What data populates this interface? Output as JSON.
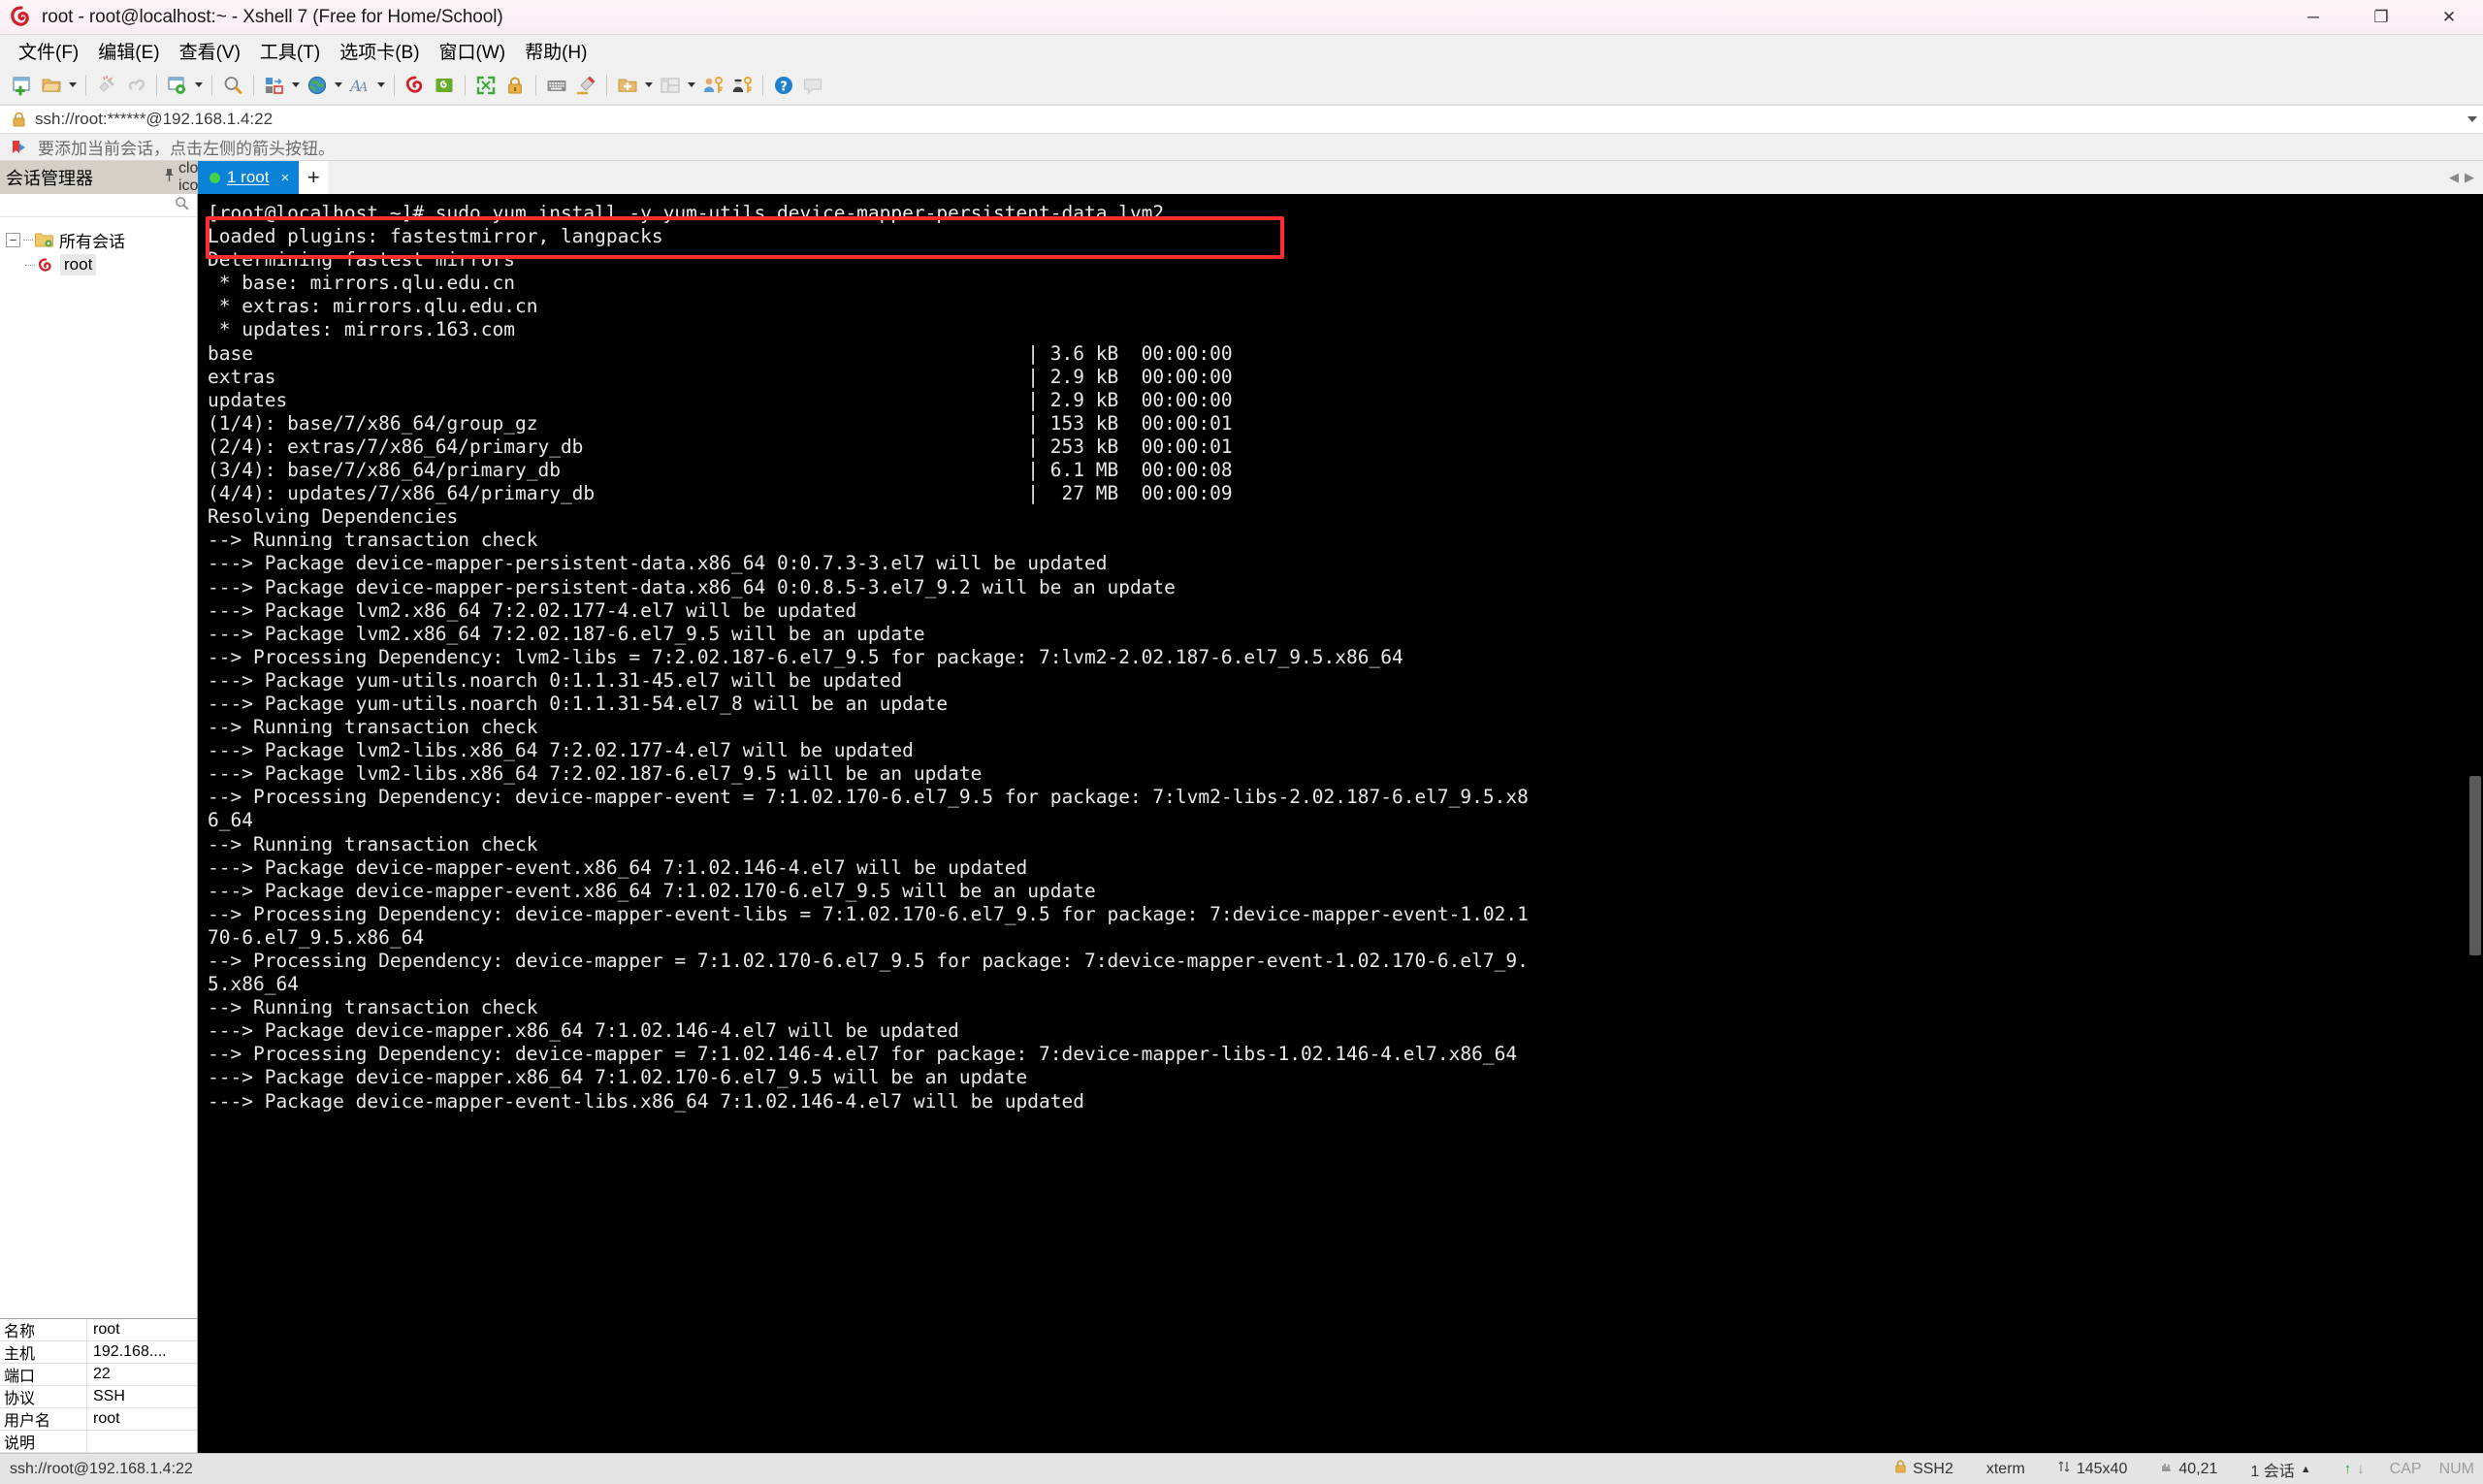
{
  "window": {
    "title": "root - root@localhost:~ - Xshell 7 (Free for Home/School)",
    "app_icon": "xshell-logo-icon",
    "minimize": "─",
    "maximize": "❐",
    "close": "✕"
  },
  "menubar": [
    {
      "label": "文件(F)",
      "name": "menu-file"
    },
    {
      "label": "编辑(E)",
      "name": "menu-edit"
    },
    {
      "label": "查看(V)",
      "name": "menu-view"
    },
    {
      "label": "工具(T)",
      "name": "menu-tools"
    },
    {
      "label": "选项卡(B)",
      "name": "menu-tabs"
    },
    {
      "label": "窗口(W)",
      "name": "menu-window"
    },
    {
      "label": "帮助(H)",
      "name": "menu-help"
    }
  ],
  "addressbar": {
    "value": "ssh://root:******@192.168.1.4:22",
    "lock_icon": "lock-icon",
    "dropdown_icon": "chevron-down-icon"
  },
  "hintbar": {
    "icon": "bookmark-arrow-icon",
    "text": "要添加当前会话，点击左侧的箭头按钮。"
  },
  "session_manager": {
    "title": "会话管理器",
    "pin_icon": "pin-icon",
    "close_icon": "close-icon",
    "search_icon": "search-icon",
    "tree": {
      "root_label": "所有会话",
      "root_icon": "folder-sessions-icon",
      "toggle": "−",
      "children": [
        {
          "label": "root",
          "icon": "xshell-session-icon",
          "selected": true
        }
      ]
    },
    "properties": [
      {
        "key": "名称",
        "value": "root"
      },
      {
        "key": "主机",
        "value": "192.168...."
      },
      {
        "key": "端口",
        "value": "22"
      },
      {
        "key": "协议",
        "value": "SSH"
      },
      {
        "key": "用户名",
        "value": "root"
      },
      {
        "key": "说明",
        "value": ""
      }
    ]
  },
  "tabs": {
    "items": [
      {
        "label": "1 root",
        "status_color": "#43d14b",
        "close": "×",
        "active": true
      }
    ],
    "new_tab": "+",
    "nav_prev": "◀",
    "nav_next": "▶"
  },
  "toolbar": {
    "groups": [
      [
        {
          "name": "new-session-icon",
          "dropdown": false
        },
        {
          "name": "open-folder-icon",
          "dropdown": true
        }
      ],
      [
        {
          "name": "disconnect-icon",
          "dropdown": false
        },
        {
          "name": "reconnect-icon",
          "dropdown": false
        }
      ],
      [
        {
          "name": "session-properties-icon",
          "dropdown": true
        }
      ],
      [
        {
          "name": "find-icon",
          "dropdown": false
        }
      ],
      [
        {
          "name": "layout-arrange-icon",
          "dropdown": true
        }
      ],
      [
        {
          "name": "globe-encoding-icon",
          "dropdown": true
        }
      ],
      [
        {
          "name": "font-icon",
          "dropdown": true
        }
      ],
      [
        {
          "name": "xshell-logo-icon",
          "dropdown": false
        },
        {
          "name": "xftp-icon",
          "dropdown": false
        }
      ],
      [
        {
          "name": "fullscreen-icon",
          "dropdown": false
        },
        {
          "name": "lock-session-icon",
          "dropdown": false
        }
      ],
      [
        {
          "name": "keyboard-icon",
          "dropdown": false
        },
        {
          "name": "highlight-pen-icon",
          "dropdown": false
        }
      ],
      [
        {
          "name": "new-folder-icon",
          "dropdown": true
        },
        {
          "name": "split-layout-icon",
          "dropdown": true
        },
        {
          "name": "user-key-icon",
          "dropdown": false
        },
        {
          "name": "agent-key-icon",
          "dropdown": false
        }
      ],
      [
        {
          "name": "help-icon",
          "dropdown": false
        },
        {
          "name": "feedback-icon",
          "dropdown": false
        }
      ]
    ]
  },
  "terminal": {
    "highlighted_command": "[root@localhost ~]# sudo yum install -y yum-utils device-mapper-persistent-data lvm2",
    "lines": [
      "[root@localhost ~]# sudo yum install -y yum-utils device-mapper-persistent-data lvm2",
      "Loaded plugins: fastestmirror, langpacks",
      "Determining fastest mirrors",
      " * base: mirrors.qlu.edu.cn",
      " * extras: mirrors.qlu.edu.cn",
      " * updates: mirrors.163.com",
      "base                                                                    | 3.6 kB  00:00:00",
      "extras                                                                  | 2.9 kB  00:00:00",
      "updates                                                                 | 2.9 kB  00:00:00",
      "(1/4): base/7/x86_64/group_gz                                           | 153 kB  00:00:01",
      "(2/4): extras/7/x86_64/primary_db                                       | 253 kB  00:00:01",
      "(3/4): base/7/x86_64/primary_db                                         | 6.1 MB  00:00:08",
      "(4/4): updates/7/x86_64/primary_db                                      |  27 MB  00:00:09",
      "Resolving Dependencies",
      "--> Running transaction check",
      "---> Package device-mapper-persistent-data.x86_64 0:0.7.3-3.el7 will be updated",
      "---> Package device-mapper-persistent-data.x86_64 0:0.8.5-3.el7_9.2 will be an update",
      "---> Package lvm2.x86_64 7:2.02.177-4.el7 will be updated",
      "---> Package lvm2.x86_64 7:2.02.187-6.el7_9.5 will be an update",
      "--> Processing Dependency: lvm2-libs = 7:2.02.187-6.el7_9.5 for package: 7:lvm2-2.02.187-6.el7_9.5.x86_64",
      "---> Package yum-utils.noarch 0:1.1.31-45.el7 will be updated",
      "---> Package yum-utils.noarch 0:1.1.31-54.el7_8 will be an update",
      "--> Running transaction check",
      "---> Package lvm2-libs.x86_64 7:2.02.177-4.el7 will be updated",
      "---> Package lvm2-libs.x86_64 7:2.02.187-6.el7_9.5 will be an update",
      "--> Processing Dependency: device-mapper-event = 7:1.02.170-6.el7_9.5 for package: 7:lvm2-libs-2.02.187-6.el7_9.5.x8",
      "6_64",
      "--> Running transaction check",
      "---> Package device-mapper-event.x86_64 7:1.02.146-4.el7 will be updated",
      "---> Package device-mapper-event.x86_64 7:1.02.170-6.el7_9.5 will be an update",
      "--> Processing Dependency: device-mapper-event-libs = 7:1.02.170-6.el7_9.5 for package: 7:device-mapper-event-1.02.1",
      "70-6.el7_9.5.x86_64",
      "--> Processing Dependency: device-mapper = 7:1.02.170-6.el7_9.5 for package: 7:device-mapper-event-1.02.170-6.el7_9.",
      "5.x86_64",
      "--> Running transaction check",
      "---> Package device-mapper.x86_64 7:1.02.146-4.el7 will be updated",
      "--> Processing Dependency: device-mapper = 7:1.02.146-4.el7 for package: 7:device-mapper-libs-1.02.146-4.el7.x86_64",
      "---> Package device-mapper.x86_64 7:1.02.170-6.el7_9.5 will be an update",
      "---> Package device-mapper-event-libs.x86_64 7:1.02.146-4.el7 will be updated"
    ]
  },
  "statusbar": {
    "connection": "ssh://root@192.168.1.4:22",
    "protocol": "SSH2",
    "protocol_icon": "lock-icon",
    "terminal_type": "xterm",
    "size": "145x40",
    "size_icon": "resize-icon",
    "cursor": "40,21",
    "cursor_icon": "cursor-icon",
    "sessions": "1 会话",
    "sessions_caret": "▲",
    "upload_icon": "↑",
    "download_icon": "↓",
    "caps": "CAP",
    "num": "NUM"
  }
}
